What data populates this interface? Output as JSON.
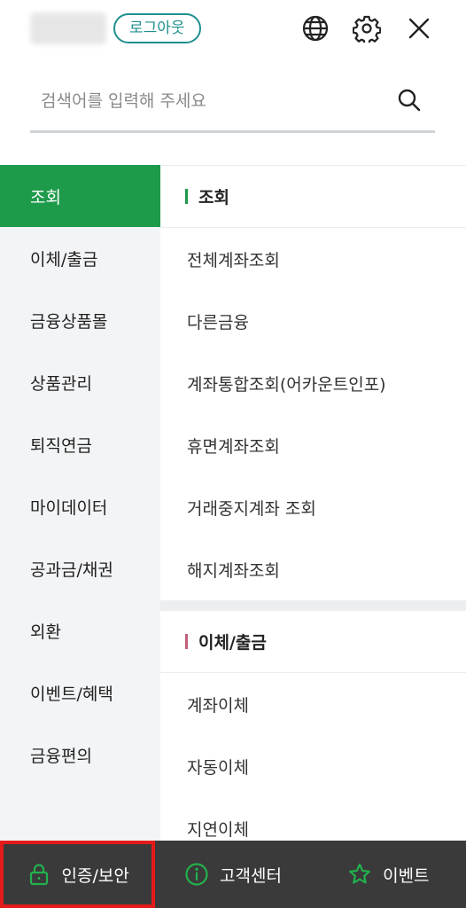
{
  "header": {
    "logout_label": "로그아웃",
    "icons": [
      "globe-icon",
      "gear-icon",
      "close-icon"
    ]
  },
  "search": {
    "placeholder": "검색어를 입력해 주세요"
  },
  "left_menu": {
    "items": [
      {
        "label": "조회",
        "active": true
      },
      {
        "label": "이체/출금",
        "active": false
      },
      {
        "label": "금융상품몰",
        "active": false
      },
      {
        "label": "상품관리",
        "active": false
      },
      {
        "label": "퇴직연금",
        "active": false
      },
      {
        "label": "마이데이터",
        "active": false
      },
      {
        "label": "공과금/채권",
        "active": false
      },
      {
        "label": "외환",
        "active": false
      },
      {
        "label": "이벤트/혜택",
        "active": false
      },
      {
        "label": "금융편의",
        "active": false
      }
    ]
  },
  "right_panel": {
    "sections": [
      {
        "title": "조회",
        "marker_color": "#1e9a4b",
        "items": [
          "전체계좌조회",
          "다른금융",
          "계좌통합조회(어카운트인포)",
          "휴면계좌조회",
          "거래중지계좌 조회",
          "해지계좌조회"
        ]
      },
      {
        "title": "이체/출금",
        "marker_color": "#c0607a",
        "items": [
          "계좌이체",
          "자동이체",
          "지연이체"
        ]
      }
    ]
  },
  "bottom_bar": {
    "items": [
      {
        "label": "인증/보안",
        "icon": "lock-icon",
        "highlighted": true
      },
      {
        "label": "고객센터",
        "icon": "info-icon",
        "highlighted": false
      },
      {
        "label": "이벤트",
        "icon": "star-icon",
        "highlighted": false
      }
    ]
  },
  "colors": {
    "accent_green": "#1e9a4b",
    "logout_teal": "#1f8f8f",
    "bottom_bar_bg": "#3a3a3a",
    "highlight_red": "#e31b1b"
  }
}
